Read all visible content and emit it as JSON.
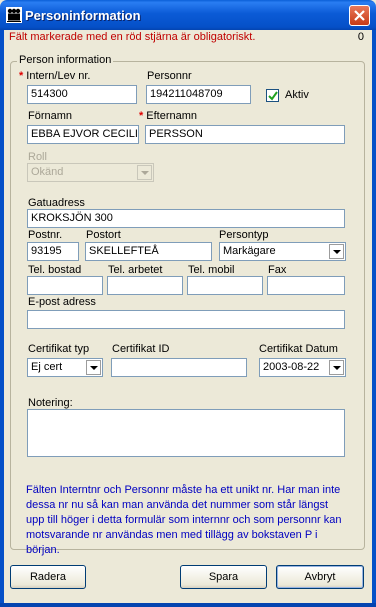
{
  "window": {
    "title": "Personinformation"
  },
  "notice": {
    "text": "Fält markerade med en röd stjärna är obligatoriskt.",
    "counter": "0"
  },
  "group": {
    "title": "Person information"
  },
  "fields": {
    "intern_nr": {
      "label": "Intern/Lev nr.",
      "value": "514300"
    },
    "personnr": {
      "label": "Personnr",
      "value": "194211048709"
    },
    "aktiv": {
      "label": "Aktiv",
      "checked": true
    },
    "fornamn": {
      "label": "Förnamn",
      "value": "EBBA EJVOR CECILI"
    },
    "efternamn": {
      "label": "Efternamn",
      "value": "PERSSON"
    },
    "roll": {
      "label": "Roll",
      "value": "Okänd"
    },
    "gatuadress": {
      "label": "Gatuadress",
      "value": "KROKSJÖN 300"
    },
    "postnr": {
      "label": "Postnr.",
      "value": "93195"
    },
    "postort": {
      "label": "Postort",
      "value": "SKELLEFTEÅ"
    },
    "persontyp": {
      "label": "Persontyp",
      "value": "Markägare"
    },
    "tel_bostad": {
      "label": "Tel. bostad",
      "value": ""
    },
    "tel_arbetet": {
      "label": "Tel. arbetet",
      "value": ""
    },
    "tel_mobil": {
      "label": "Tel. mobil",
      "value": ""
    },
    "fax": {
      "label": "Fax",
      "value": ""
    },
    "epost": {
      "label": "E-post adress",
      "value": ""
    },
    "certifikat_typ": {
      "label": "Certifikat typ",
      "value": "Ej cert"
    },
    "certifikat_id": {
      "label": "Certifikat ID",
      "value": ""
    },
    "certifikat_datum": {
      "label": "Certifikat Datum",
      "value": "2003-08-22"
    },
    "notering": {
      "label": "Notering:",
      "value": ""
    }
  },
  "info_text": "Fälten Interntnr och Personnr måste ha ett unikt nr. Har man inte dessa nr nu så kan man använda det nummer som står längst upp till höger i detta formulär som internnr och som personnr kan motsvarande nr användas men med tillägg av bokstaven P i början.",
  "buttons": {
    "delete": "Radera",
    "save": "Spara",
    "cancel": "Avbryt"
  },
  "colors": {
    "required_star": "#e00000",
    "notice": "#c00000",
    "info": "#0000c0",
    "titlebar": "#0550c8"
  },
  "icons": {
    "title": "people-icon",
    "close": "close-icon",
    "check": "checkmark-icon"
  }
}
